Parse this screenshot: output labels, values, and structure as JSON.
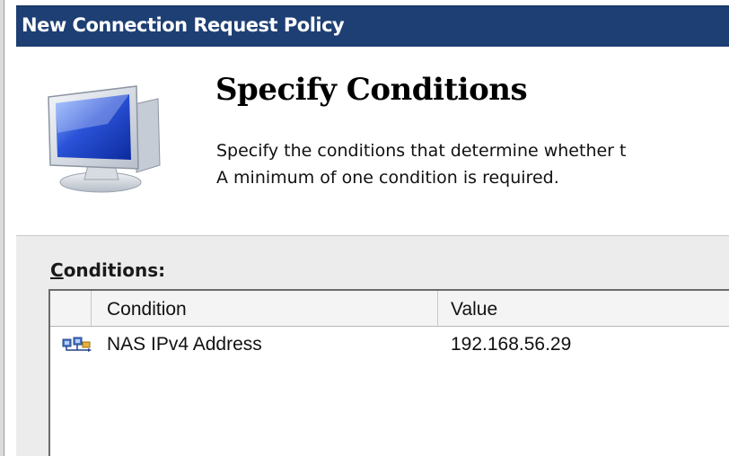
{
  "window": {
    "title": "New Connection Request Policy"
  },
  "header": {
    "icon": "computer-monitor-icon",
    "title": "Specify Conditions",
    "description_line1": "Specify the conditions that determine whether t",
    "description_line2": "A minimum of one condition is required."
  },
  "conditions": {
    "label_mnemonic": "C",
    "label_rest": "onditions:",
    "columns": [
      "Condition",
      "Value"
    ],
    "rows": [
      {
        "icon": "nas-network-icon",
        "condition": "NAS IPv4 Address",
        "value": "192.168.56.29"
      }
    ]
  },
  "colors": {
    "title_bar": "#1e3f73",
    "body_background": "#ececec",
    "header_background": "#ffffff"
  }
}
